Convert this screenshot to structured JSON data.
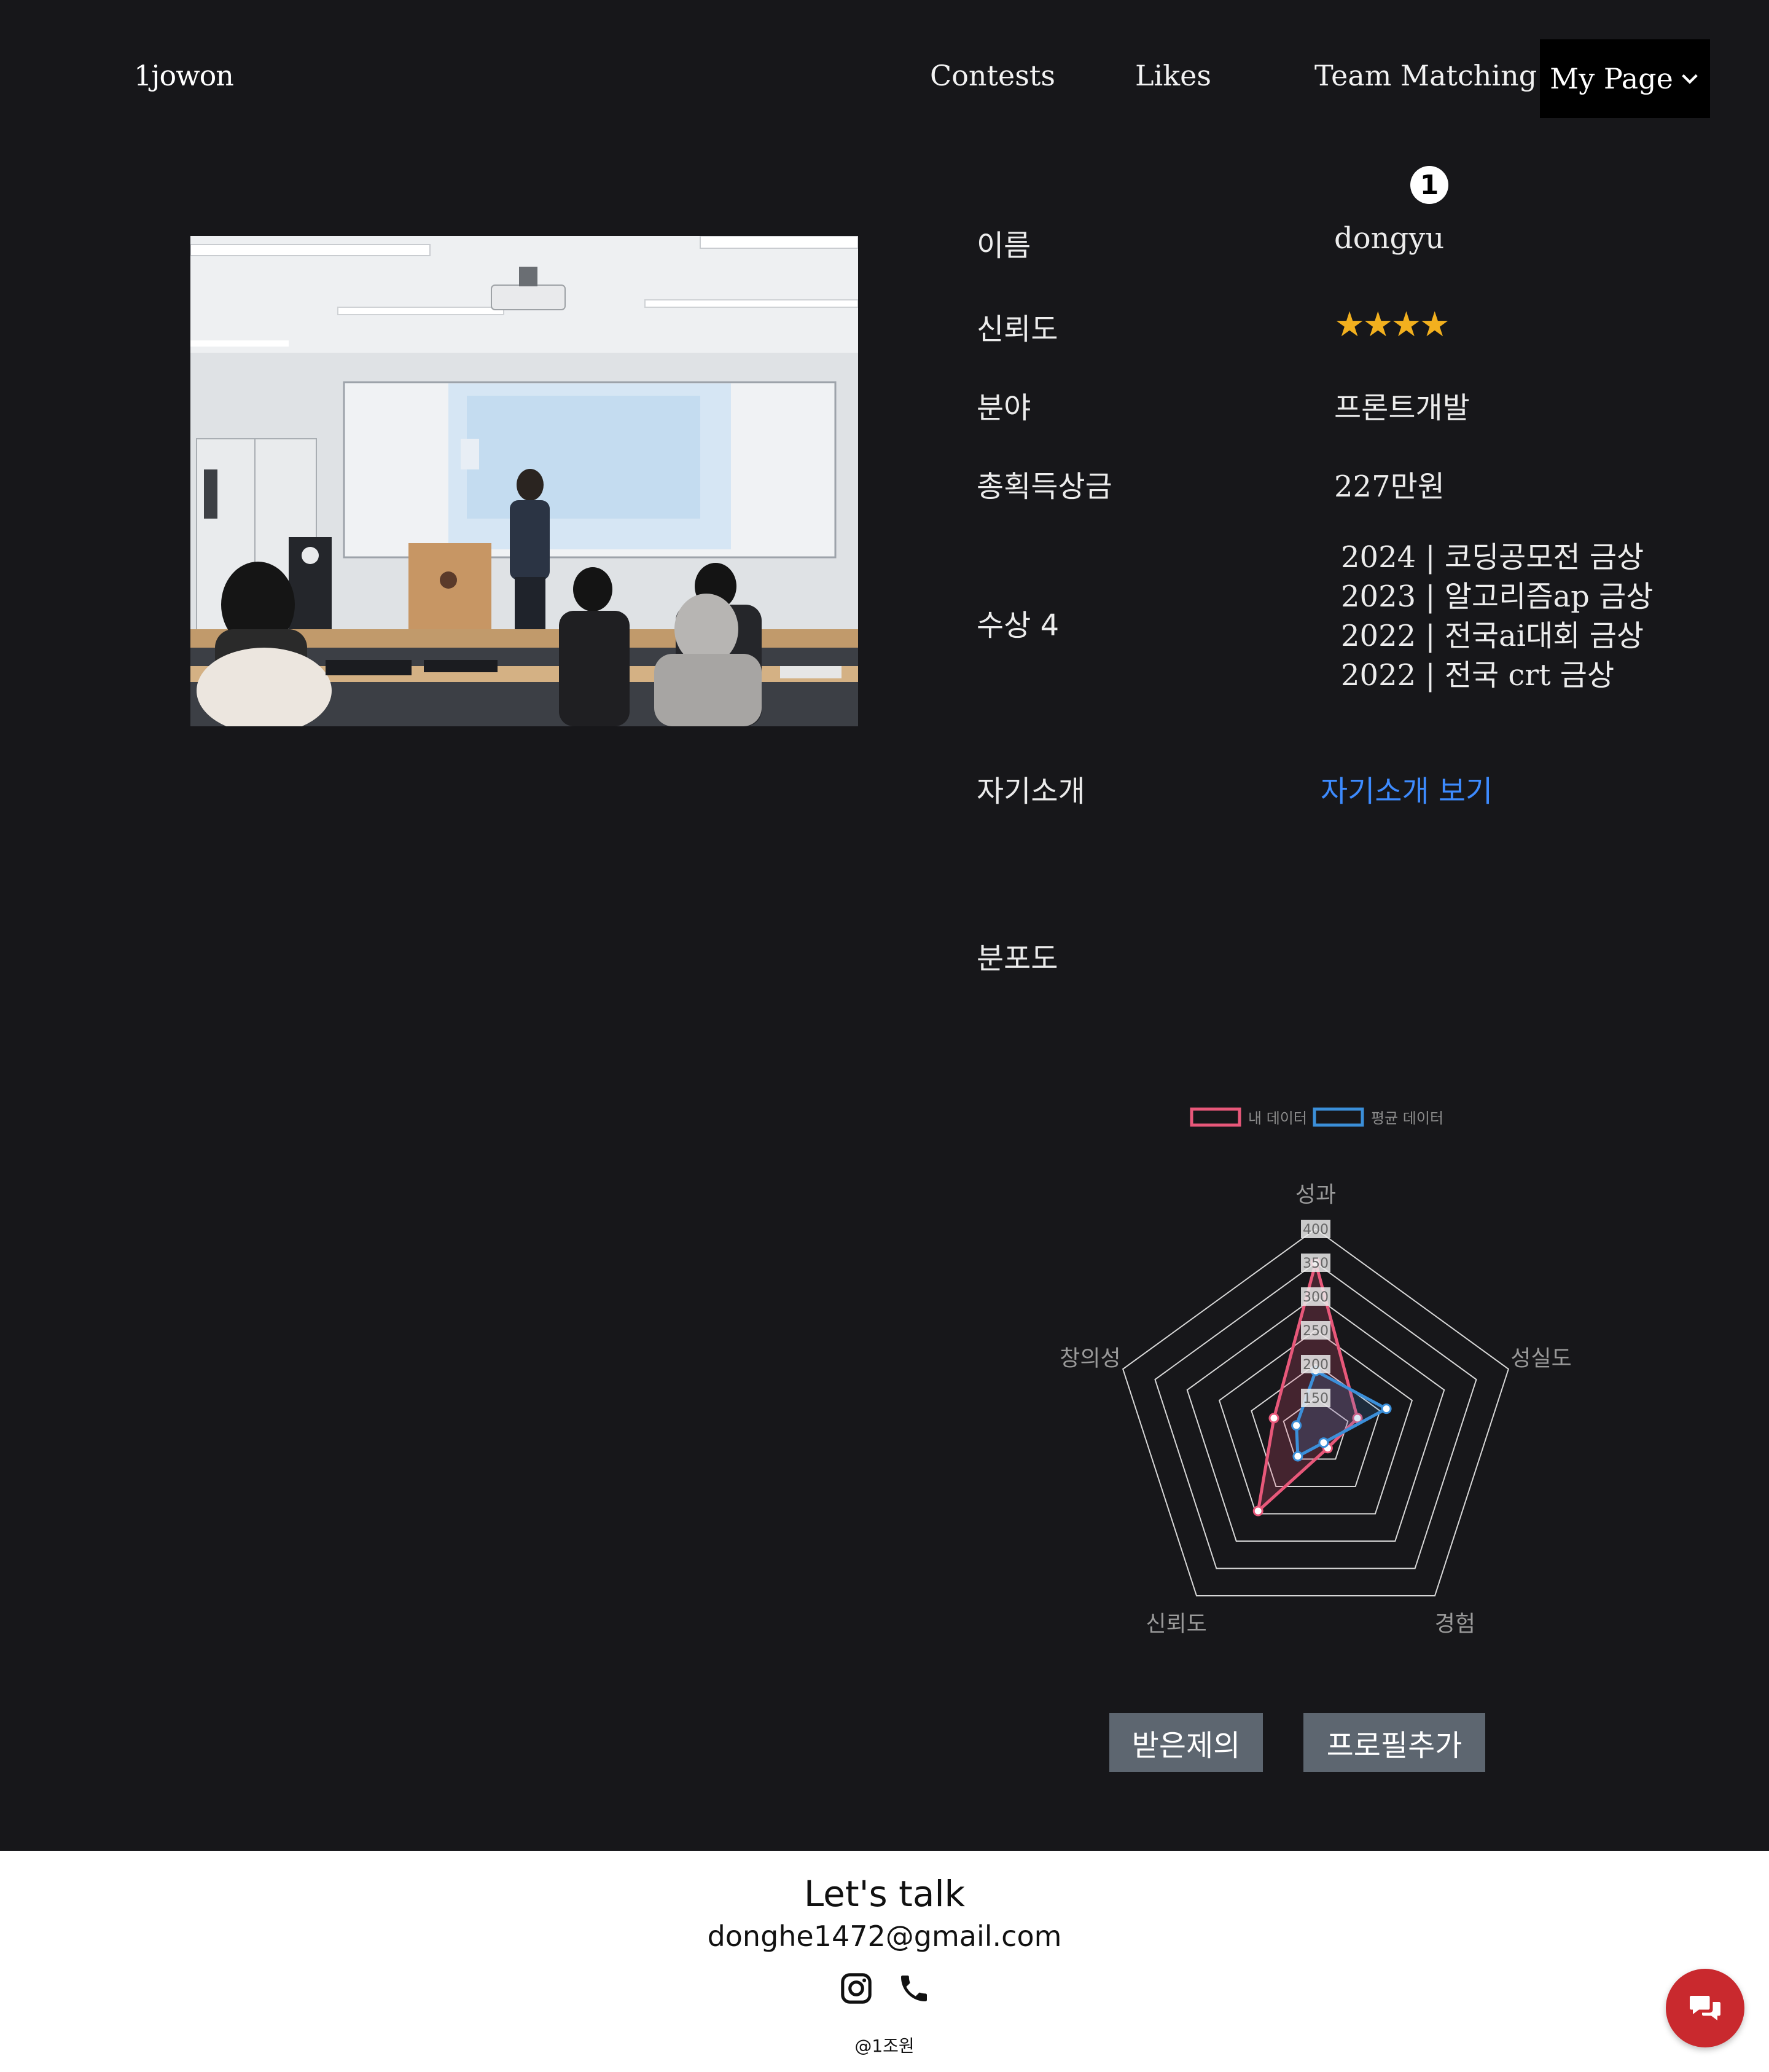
{
  "nav": {
    "brand": "1jowon",
    "links": [
      "Contests",
      "Likes",
      "Team Matching"
    ],
    "mypage": "My Page"
  },
  "profile": {
    "badge": "1",
    "name_label": "이름",
    "name_value": "dongyu",
    "trust_label": "신뢰도",
    "trust_stars": "★★★★",
    "trust_rating": 4,
    "field_label": "분야",
    "field_value": "프론트개발",
    "prize_label": "총획득상금",
    "prize_value": "227만원",
    "awards_label": "수상 4",
    "awards": [
      "2024 | 코딩공모전 금상",
      "2023 | 알고리즘ap 금상",
      "2022 | 전국ai대회 금상",
      "2022 | 전국 crt 금상"
    ],
    "intro_label": "자기소개",
    "intro_link": "자기소개 보기",
    "dist_label": "분포도"
  },
  "chart_data": {
    "type": "radar",
    "legend": [
      "내 데이터",
      "평균 데이터"
    ],
    "axes": [
      "성과",
      "성실도",
      "경험",
      "신뢰도",
      "창의성"
    ],
    "ticks": [
      "400",
      "350",
      "300",
      "250",
      "200",
      "150"
    ],
    "rlim": [
      100,
      400
    ],
    "colors": {
      "mine": "#e8587a",
      "avg": "#3b8fd9"
    },
    "series": [
      {
        "name": "내 데이터",
        "values": [
          350,
          165,
          130,
          245,
          165
        ]
      },
      {
        "name": "평균 데이터",
        "values": [
          190,
          210,
          120,
          145,
          130
        ]
      }
    ]
  },
  "buttons": {
    "received": "받은제의",
    "add_profile": "프로필추가"
  },
  "footer": {
    "title": "Let's talk",
    "email": "donghe1472@gmail.com",
    "copyright": "@1조원"
  }
}
